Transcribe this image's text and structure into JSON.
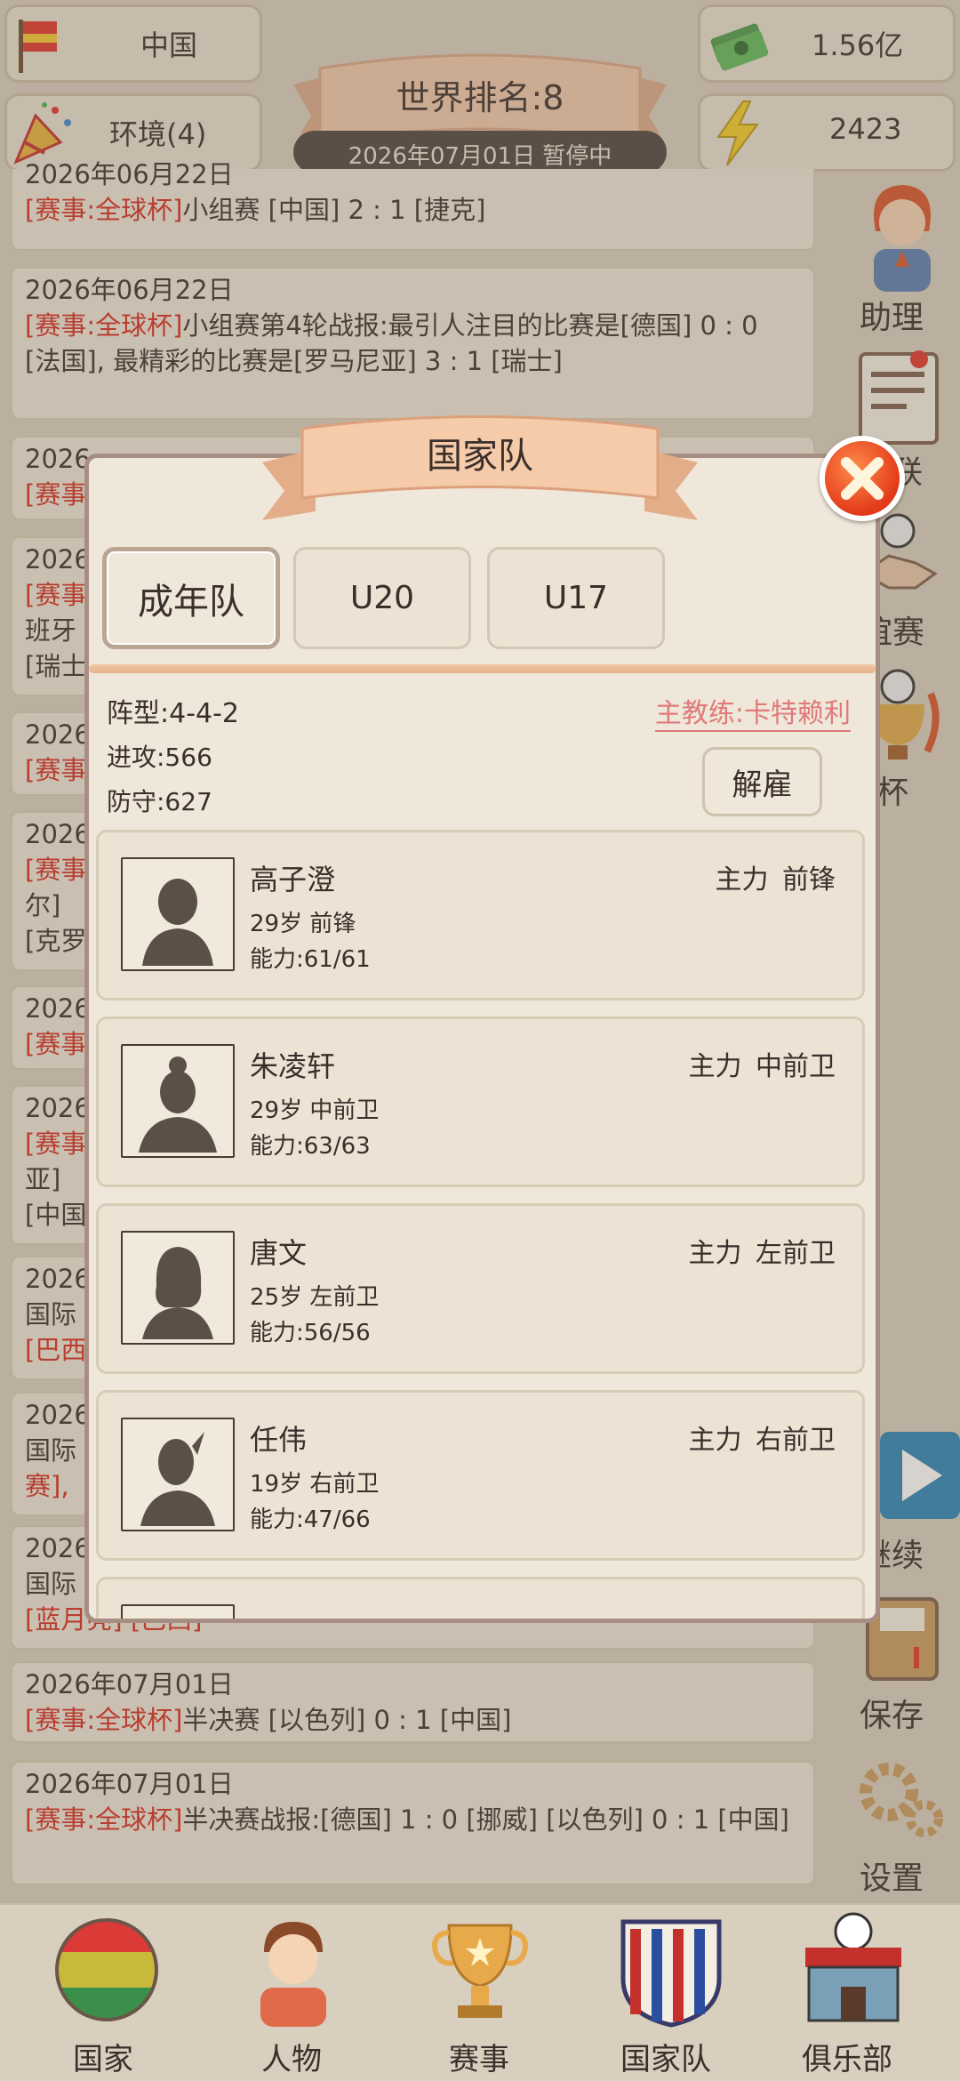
{
  "top": {
    "country": "中国",
    "environment": "环境(4)",
    "money": "1.56亿",
    "energy": "2423",
    "world_rank": "世界排名:8",
    "date_status": "2026年07月01日 暂停中"
  },
  "news": [
    {
      "date": "2026年06月22日",
      "tag": "[赛事:全球杯]",
      "text": "小组赛 [中国] 2 : 1 [捷克]"
    },
    {
      "date": "2026年06月22日",
      "tag": "[赛事:全球杯]",
      "text": "小组赛第4轮战报:最引人注目的比赛是[德国] 0 : 0 [法国], 最精彩的比赛是[罗马尼亚] 3 : 1 [瑞士]"
    },
    {
      "date": "2026",
      "tag": "[赛事",
      "text": ""
    },
    {
      "date": "2026",
      "tag": "[赛事",
      "text": "班牙",
      "extra": "[瑞士"
    },
    {
      "date": "2026",
      "tag": "[赛事",
      "text": ""
    },
    {
      "date": "2026",
      "tag": "[赛事",
      "text": "尔]",
      "extra": "[克罗"
    },
    {
      "date": "2026",
      "tag": "[赛事",
      "text": ""
    },
    {
      "date": "2026",
      "tag": "[赛事",
      "text": "亚]",
      "extra": "[中国"
    },
    {
      "date": "2026",
      "tag": "国际",
      "text": "[巴西"
    },
    {
      "date": "2026",
      "tag": "国际",
      "text": "赛],"
    },
    {
      "date": "2026",
      "tag": "国际",
      "text": "[蓝月亮] [巴西]"
    },
    {
      "date": "2026年07月01日",
      "tag": "[赛事:全球杯]",
      "text": "半决赛 [以色列] 0 : 1 [中国]"
    },
    {
      "date": "2026年07月01日",
      "tag": "[赛事:全球杯]",
      "text": "半决赛战报:[德国] 1 : 0 [挪威] [以色列] 0 : 1 [中国]"
    }
  ],
  "side_menu": {
    "assistant": "助理",
    "league": "联",
    "friendly": "谊赛",
    "globalcup": "球杯",
    "continue": "继续",
    "save": "保存",
    "settings": "设置"
  },
  "modal": {
    "title": "国家队",
    "tabs": [
      "成年队",
      "U20",
      "U17"
    ],
    "formation": "阵型:4-4-2",
    "attack": "进攻:566",
    "defense": "防守:627",
    "coach": "主教练:卡特赖利",
    "fire_label": "解雇",
    "players": [
      {
        "name": "高子澄",
        "role": "主力 前锋",
        "age_pos": "29岁 前锋",
        "ability": "能力:61/61"
      },
      {
        "name": "朱凌轩",
        "role": "主力 中前卫",
        "age_pos": "29岁 中前卫",
        "ability": "能力:63/63"
      },
      {
        "name": "唐文",
        "role": "主力 左前卫",
        "age_pos": "25岁 左前卫",
        "ability": "能力:56/56"
      },
      {
        "name": "任伟",
        "role": "主力 右前卫",
        "age_pos": "19岁 右前卫",
        "ability": "能力:47/66"
      }
    ]
  },
  "bottom_nav": {
    "country": "国家",
    "people": "人物",
    "events": "赛事",
    "national_team": "国家队",
    "club": "俱乐部"
  }
}
